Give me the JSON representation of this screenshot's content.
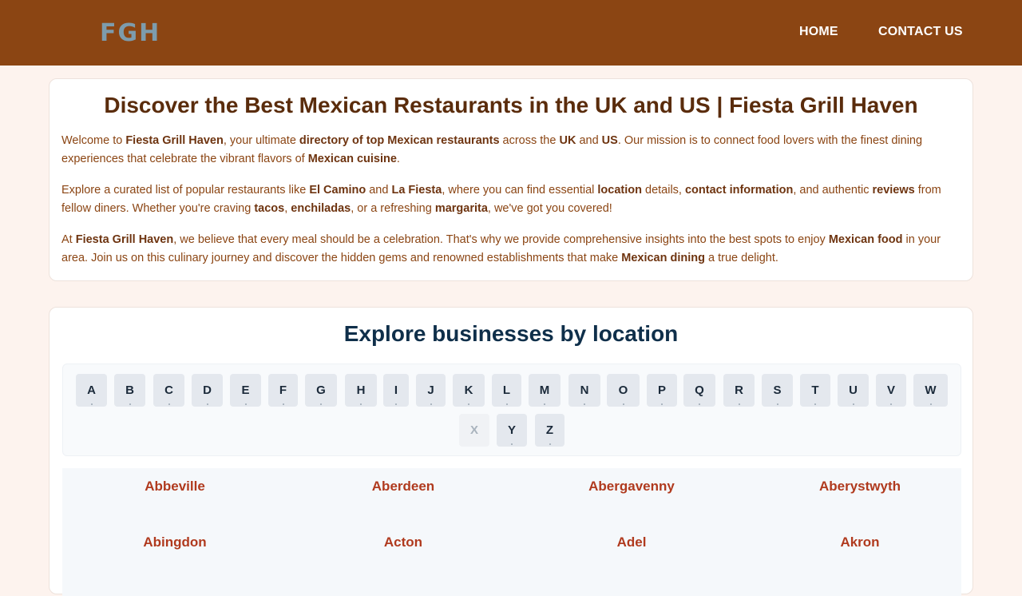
{
  "header": {
    "logo": "FGH",
    "nav": [
      "HOME",
      "CONTACT US"
    ],
    "bg_color": "#8b4513"
  },
  "intro": {
    "title": "Discover the Best Mexican Restaurants in the UK and US | Fiesta Grill Haven",
    "p1": [
      {
        "t": "Welcome to "
      },
      {
        "t": "Fiesta Grill Haven",
        "b": true
      },
      {
        "t": ", your ultimate "
      },
      {
        "t": "directory of top Mexican restaurants",
        "b": true
      },
      {
        "t": " across the "
      },
      {
        "t": "UK",
        "b": true
      },
      {
        "t": " and "
      },
      {
        "t": "US",
        "b": true
      },
      {
        "t": ". Our mission is to connect food lovers with the finest dining experiences that celebrate the vibrant flavors of "
      },
      {
        "t": "Mexican cuisine",
        "b": true
      },
      {
        "t": "."
      }
    ],
    "p2": [
      {
        "t": "Explore a curated list of popular restaurants like "
      },
      {
        "t": "El Camino",
        "b": true
      },
      {
        "t": " and "
      },
      {
        "t": "La Fiesta",
        "b": true
      },
      {
        "t": ", where you can find essential "
      },
      {
        "t": "location",
        "b": true
      },
      {
        "t": " details, "
      },
      {
        "t": "contact information",
        "b": true
      },
      {
        "t": ", and authentic "
      },
      {
        "t": "reviews",
        "b": true
      },
      {
        "t": " from fellow diners. Whether you're craving "
      },
      {
        "t": "tacos",
        "b": true
      },
      {
        "t": ", "
      },
      {
        "t": "enchiladas",
        "b": true
      },
      {
        "t": ", or a refreshing "
      },
      {
        "t": "margarita",
        "b": true
      },
      {
        "t": ", we've got you covered!"
      }
    ],
    "p3": [
      {
        "t": "At "
      },
      {
        "t": "Fiesta Grill Haven",
        "b": true
      },
      {
        "t": ", we believe that every meal should be a celebration. That's why we provide comprehensive insights into the best spots to enjoy "
      },
      {
        "t": "Mexican food",
        "b": true
      },
      {
        "t": " in your area. Join us on this culinary journey and discover the hidden gems and renowned establishments that make "
      },
      {
        "t": "Mexican dining",
        "b": true
      },
      {
        "t": " a true delight."
      }
    ]
  },
  "locations": {
    "title": "Explore businesses by location",
    "letters": [
      "A",
      "B",
      "C",
      "D",
      "E",
      "F",
      "G",
      "H",
      "I",
      "J",
      "K",
      "L",
      "M",
      "N",
      "O",
      "P",
      "Q",
      "R",
      "S",
      "T",
      "U",
      "V",
      "W",
      "X",
      "Y",
      "Z"
    ],
    "disabled_letters": [
      "X"
    ],
    "cities": [
      "Abbeville",
      "Aberdeen",
      "Abergavenny",
      "Aberystwyth",
      "Abingdon",
      "Acton",
      "Adel",
      "Akron"
    ]
  }
}
